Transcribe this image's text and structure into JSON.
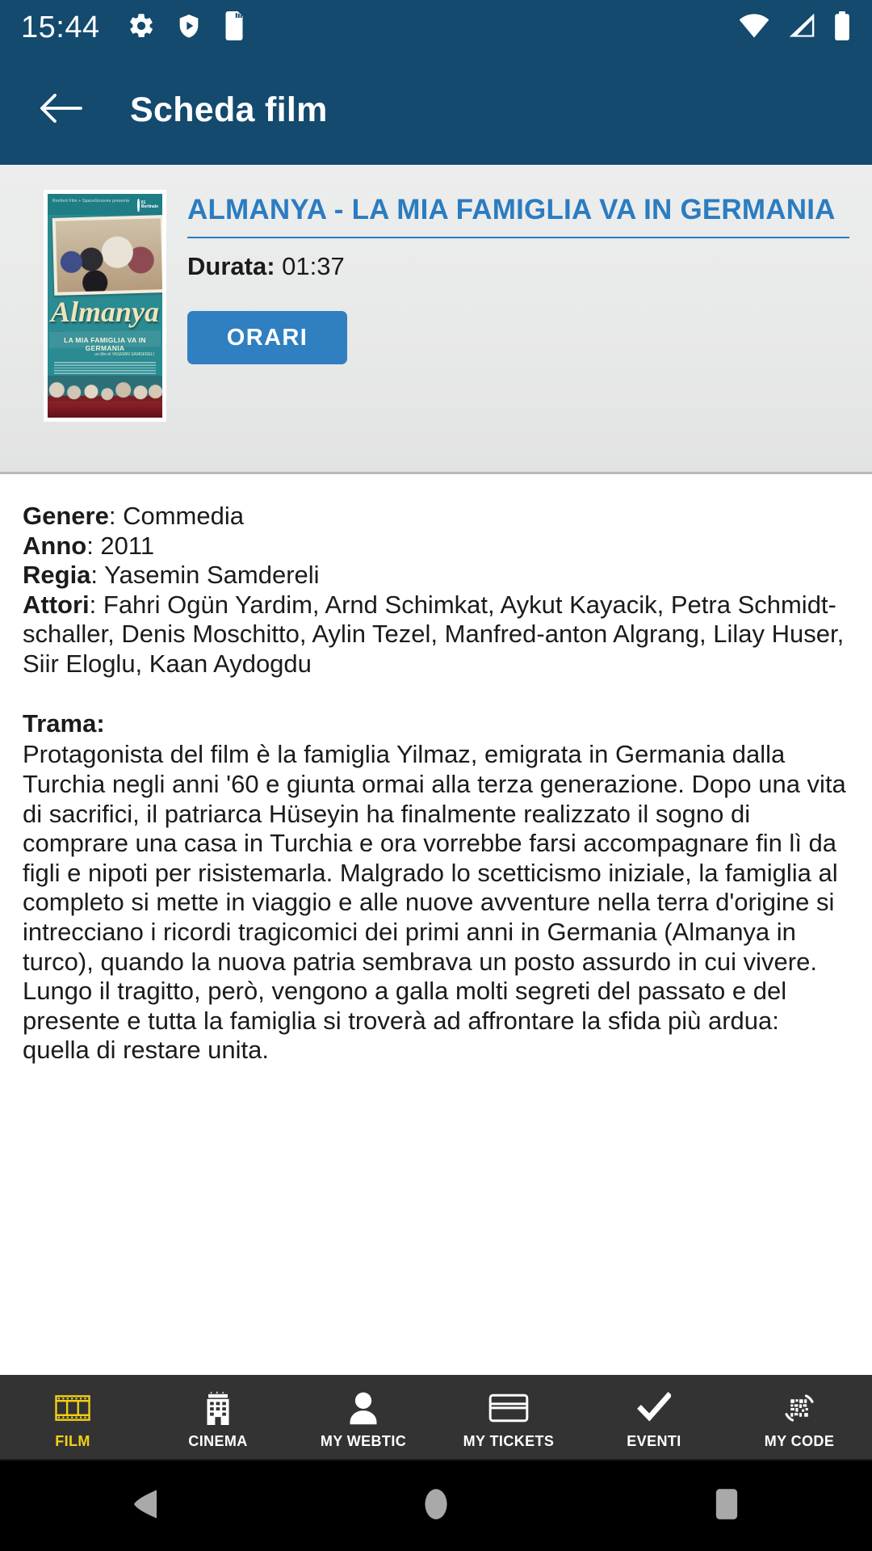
{
  "statusbar": {
    "time": "15:44",
    "left_icons": [
      "gear-icon",
      "shield-play-icon",
      "sd-card-icon"
    ],
    "right_icons": [
      "wifi-icon",
      "cellular-signal-icon",
      "battery-icon"
    ],
    "background": "#134A6E"
  },
  "appbar": {
    "back_icon": "arrow-left-icon",
    "title": "Scheda film",
    "background": "#134A6E"
  },
  "movie": {
    "poster": {
      "alt": "Almanya - La mia famiglia va in Germania movie poster",
      "script_title": "Almanya",
      "subtitle": "LA MIA FAMIGLIA VA IN GERMANIA",
      "credit_top": "Roxford Film + SpaceGrooves presenta",
      "festival": "61 Berlinale",
      "director_credit": "un film di YASEMIN SAMDERELI"
    },
    "title": "ALMANYA - LA MIA FAMIGLIA VA IN GERMANIA",
    "title_color": "#2b7cc0",
    "duration_label": "Durata:",
    "duration_value": "01:37",
    "orari_button": "ORARI",
    "orari_color": "#2f7fc1"
  },
  "details": {
    "genere_label": "Genere",
    "genere_value": ": Commedia",
    "anno_label": "Anno",
    "anno_value": ": 2011",
    "regia_label": "Regia",
    "regia_value": ": Yasemin Samdereli",
    "attori_label": "Attori",
    "attori_value": ": Fahri Ogün Yardim, Arnd Schimkat, Aykut Kayacik, Petra Schmidt-schaller, Denis Moschitto, Aylin Tezel, Manfred-anton Algrang, Lilay Huser, Siir Eloglu, Kaan Aydogdu",
    "trama_label": "Trama",
    "trama_colon": ":",
    "trama_text": "Protagonista del film è la famiglia Yilmaz, emigrata in Germania dalla Turchia negli anni '60 e giunta ormai alla terza generazione. Dopo una vita di sacrifici, il patriarca Hüseyin ha finalmente realizzato il sogno di comprare una casa in Turchia e ora vorrebbe farsi accompagnare fin lì da figli e nipoti per risistemarla. Malgrado lo scetticismo iniziale, la famiglia al completo si mette in viaggio e alle nuove avventure nella terra d'origine si intrecciano i ricordi tragicomici dei primi anni in Germania (Almanya in turco), quando la nuova patria sembrava un posto assurdo in cui vivere. Lungo il tragitto, però, vengono a galla molti segreti del passato e del presente e tutta la famiglia si troverà ad affrontare la sfida più ardua: quella di restare unita."
  },
  "tabbar": {
    "background": "#333333",
    "active_color": "#f2d117",
    "items": [
      {
        "label": "FILM",
        "icon": "film-strip-icon",
        "active": true
      },
      {
        "label": "CINEMA",
        "icon": "building-icon",
        "active": false
      },
      {
        "label": "MY WEBTIC",
        "icon": "person-icon",
        "active": false
      },
      {
        "label": "MY TICKETS",
        "icon": "credit-card-icon",
        "active": false
      },
      {
        "label": "EVENTI",
        "icon": "check-icon",
        "active": false
      },
      {
        "label": "MY CODE",
        "icon": "qr-code-icon",
        "active": false
      }
    ]
  },
  "navbar": {
    "buttons": [
      "back-triangle-icon",
      "home-circle-icon",
      "recents-square-icon"
    ]
  }
}
